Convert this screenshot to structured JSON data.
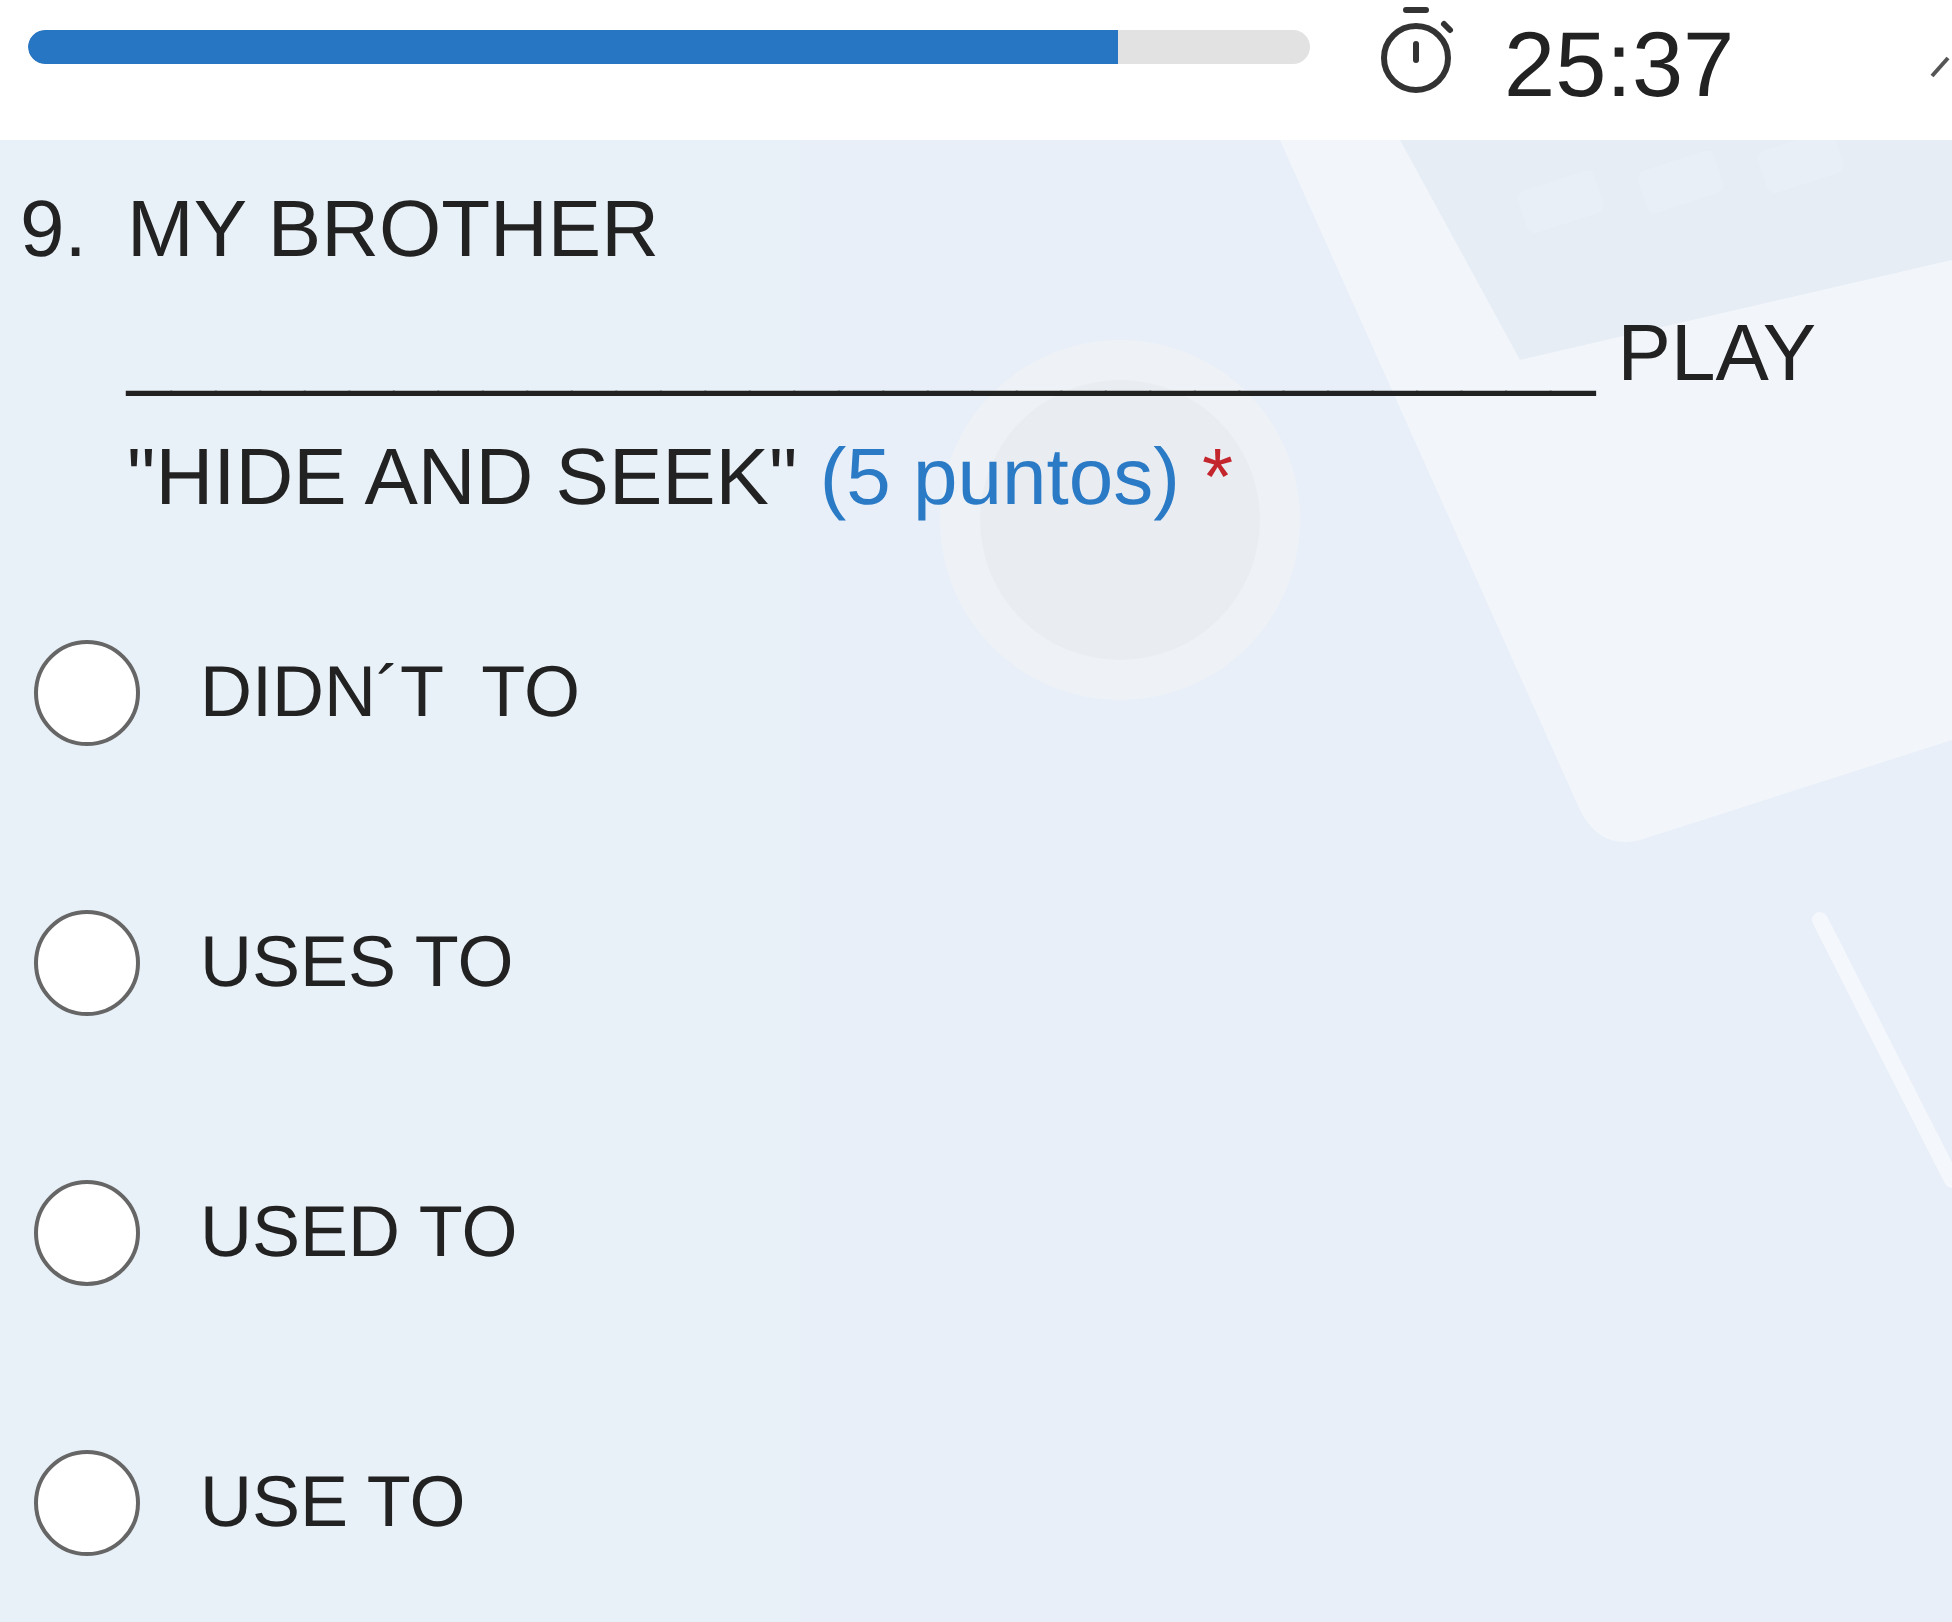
{
  "header": {
    "progress": {
      "level": 0.85
    },
    "timer": "25:37"
  },
  "question": {
    "number": "9.",
    "text": "MY BROTHER _________________________________ PLAY \"HIDE AND SEEK\"",
    "points": "(5 puntos)",
    "required_mark": "*"
  },
  "options": [
    {
      "label": "DIDN´T  TO",
      "selected": false
    },
    {
      "label": "USES TO",
      "selected": false
    },
    {
      "label": "USED TO",
      "selected": false
    },
    {
      "label": "USE TO",
      "selected": false
    }
  ]
}
